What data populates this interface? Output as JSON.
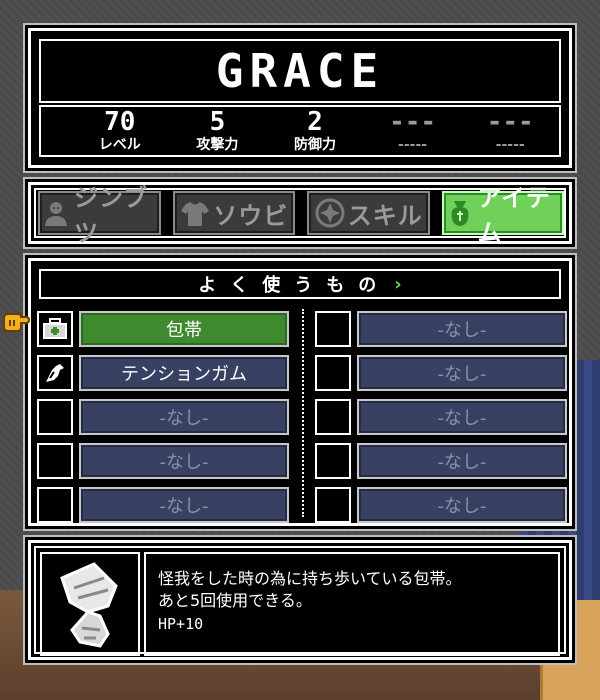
{
  "character": {
    "name": "GRACE"
  },
  "stats": [
    {
      "value": "70",
      "label": "レベル"
    },
    {
      "value": "5",
      "label": "攻撃力"
    },
    {
      "value": "2",
      "label": "防御力"
    },
    {
      "value": "---",
      "label": "-----"
    },
    {
      "value": "---",
      "label": "-----"
    }
  ],
  "tabs": [
    {
      "label": "ジンブツ",
      "icon": "person-icon"
    },
    {
      "label": "ソウビ",
      "icon": "shirt-icon"
    },
    {
      "label": "スキル",
      "icon": "skill-emblem-icon"
    },
    {
      "label": "アイテム",
      "icon": "item-bag-icon"
    }
  ],
  "active_tab": "アイテム",
  "items_section": {
    "title": "よく使うもの",
    "next_arrow": "›"
  },
  "items_left": [
    {
      "icon": "first-aid-kit-icon",
      "name": "包帯"
    },
    {
      "icon": "gum-icon",
      "name": "テンションガム"
    },
    {
      "icon": "",
      "name": "-なし-"
    },
    {
      "icon": "",
      "name": "-なし-"
    },
    {
      "icon": "",
      "name": "-なし-"
    }
  ],
  "items_right": [
    {
      "icon": "",
      "name": "-なし-"
    },
    {
      "icon": "",
      "name": "-なし-"
    },
    {
      "icon": "",
      "name": "-なし-"
    },
    {
      "icon": "",
      "name": "-なし-"
    },
    {
      "icon": "",
      "name": "-なし-"
    }
  ],
  "selected_item": "包帯",
  "description": {
    "icon": "bandage-icon",
    "line1": "怪我をした時の為に持ち歩いている包帯。",
    "line2": "あと5回使用できる。",
    "effect": "HP+10"
  },
  "colors": {
    "active_tab": "#6fd05a",
    "selected_slot": "#3f8a2e",
    "empty_slot": "#394163",
    "panel_bg": "#000000",
    "border": "#ffffff"
  }
}
